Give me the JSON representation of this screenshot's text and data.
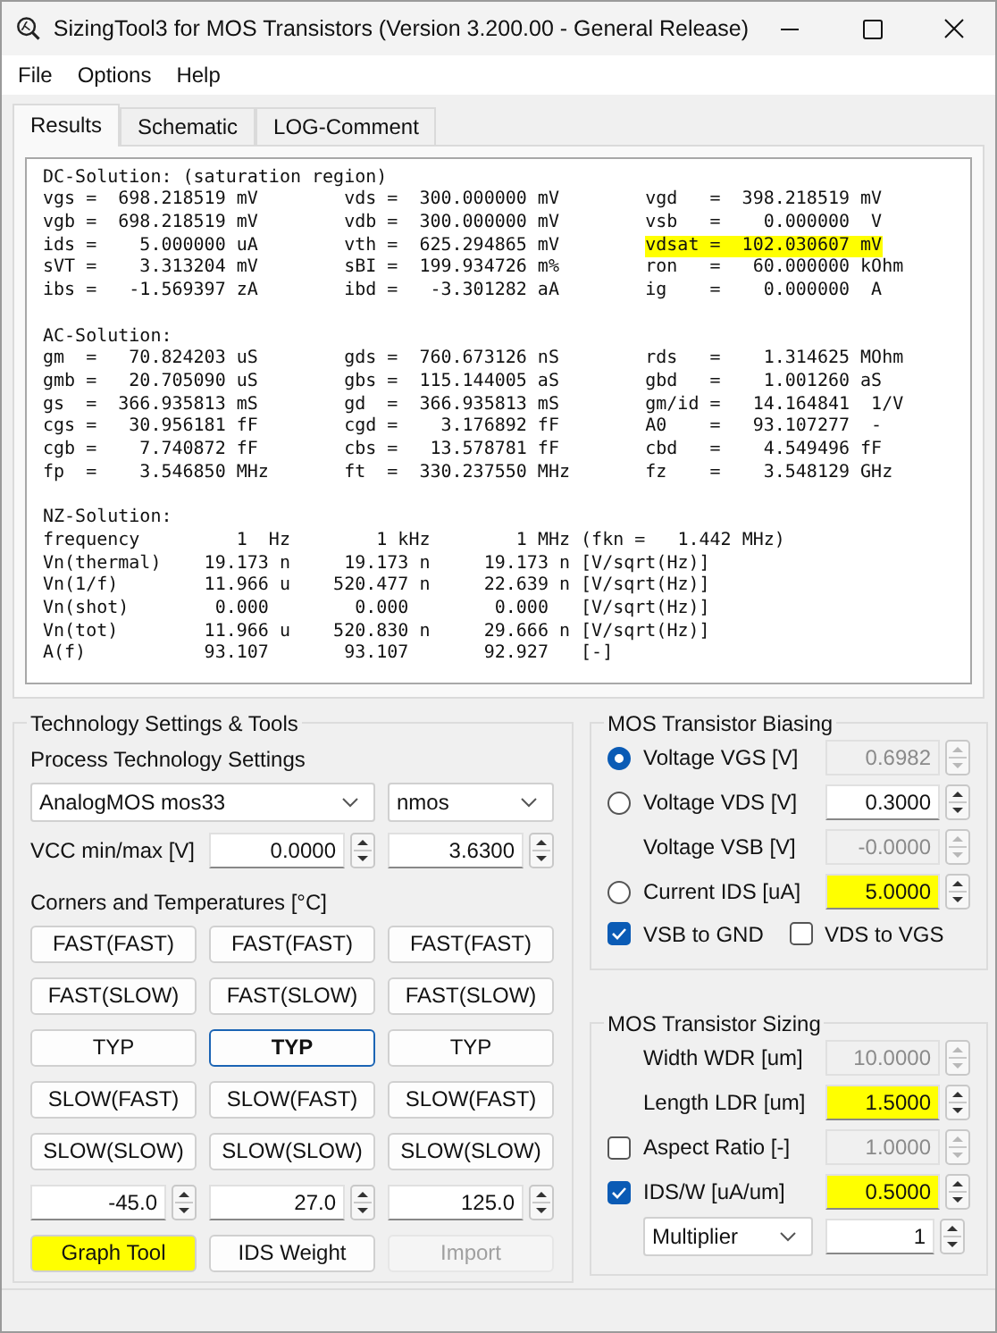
{
  "window": {
    "title": "SizingTool3 for MOS Transistors (Version 3.200.00 - General Release)"
  },
  "menu": [
    "File",
    "Options",
    "Help"
  ],
  "tabs": [
    {
      "label": "Results",
      "selected": true
    },
    {
      "label": "Schematic",
      "selected": false
    },
    {
      "label": "LOG-Comment",
      "selected": false
    }
  ],
  "results": [
    {
      "kind": "table",
      "title": "DC-Solution: (saturation region)",
      "rows": [
        [
          {
            "text": "vgs =  698.218519 mV",
            "highlighted": false
          },
          {
            "text": "vds =  300.000000 mV",
            "highlighted": false
          },
          {
            "text": "vgd   =  398.218519 mV",
            "highlighted": false
          }
        ],
        [
          {
            "text": "vgb =  698.218519 mV",
            "highlighted": false
          },
          {
            "text": "vdb =  300.000000 mV",
            "highlighted": false
          },
          {
            "text": "vsb   =    0.000000  V",
            "highlighted": false
          }
        ],
        [
          {
            "text": "ids =    5.000000 uA",
            "highlighted": false
          },
          {
            "text": "vth =  625.294865 mV",
            "highlighted": false
          },
          {
            "text": "vdsat =  102.030607 mV",
            "highlighted": true
          }
        ],
        [
          {
            "text": "sVT =    3.313204 mV",
            "highlighted": false
          },
          {
            "text": "sBI =  199.934726 m%",
            "highlighted": false
          },
          {
            "text": "ron   =   60.000000 kOhm",
            "highlighted": false
          }
        ],
        [
          {
            "text": "ibs =   -1.569397 zA",
            "highlighted": false
          },
          {
            "text": "ibd =   -3.301282 aA",
            "highlighted": false
          },
          {
            "text": "ig    =    0.000000  A",
            "highlighted": false
          }
        ]
      ]
    },
    {
      "kind": "table",
      "title": "AC-Solution:",
      "rows": [
        [
          {
            "text": "gm  =   70.824203 uS",
            "highlighted": false
          },
          {
            "text": "gds =  760.673126 nS",
            "highlighted": false
          },
          {
            "text": "rds   =    1.314625 MOhm",
            "highlighted": false
          }
        ],
        [
          {
            "text": "gmb =   20.705090 uS",
            "highlighted": false
          },
          {
            "text": "gbs =  115.144005 aS",
            "highlighted": false
          },
          {
            "text": "gbd   =    1.001260 aS",
            "highlighted": false
          }
        ],
        [
          {
            "text": "gs  =  366.935813 mS",
            "highlighted": false
          },
          {
            "text": "gd  =  366.935813 mS",
            "highlighted": false
          },
          {
            "text": "gm/id =   14.164841  1/V",
            "highlighted": false
          }
        ],
        [
          {
            "text": "cgs =   30.956181 fF",
            "highlighted": false
          },
          {
            "text": "cgd =    3.176892 fF",
            "highlighted": false
          },
          {
            "text": "A0    =   93.107277  -",
            "highlighted": false
          }
        ],
        [
          {
            "text": "cgb =    7.740872 fF",
            "highlighted": false
          },
          {
            "text": "cbs =   13.578781 fF",
            "highlighted": false
          },
          {
            "text": "cbd   =    4.549496 fF",
            "highlighted": false
          }
        ],
        [
          {
            "text": "fp  =    3.546850 MHz",
            "highlighted": false
          },
          {
            "text": "ft  =  330.237550 MHz",
            "highlighted": false
          },
          {
            "text": "fz    =    3.548129 GHz",
            "highlighted": false
          }
        ]
      ]
    },
    {
      "kind": "text",
      "title": "NZ-Solution:",
      "lines": [
        "frequency         1  Hz        1 kHz        1 MHz (fkn =   1.442 MHz)",
        "Vn(thermal)    19.173 n     19.173 n     19.173 n [V/sqrt(Hz)]",
        "Vn(1/f)        11.966 u    520.477 n     22.639 n [V/sqrt(Hz)]",
        "Vn(shot)        0.000        0.000        0.000   [V/sqrt(Hz)]",
        "Vn(tot)        11.966 u    520.830 n     29.666 n [V/sqrt(Hz)]",
        "A(f)           93.107       93.107       92.927   [-]"
      ]
    }
  ],
  "technology": {
    "title": "Technology Settings & Tools",
    "process_label": "Process Technology Settings",
    "process": "AnalogMOS mos33",
    "device": "nmos",
    "vcc": {
      "label": "VCC min/max [V]",
      "min": "0.0000",
      "max": "3.6300"
    },
    "corners_label": "Corners and Temperatures [°C]",
    "corners": [
      [
        {
          "label": "FAST(FAST)",
          "focused": false
        },
        {
          "label": "FAST(FAST)",
          "focused": false
        },
        {
          "label": "FAST(FAST)",
          "focused": false
        }
      ],
      [
        {
          "label": "FAST(SLOW)",
          "focused": false
        },
        {
          "label": "FAST(SLOW)",
          "focused": false
        },
        {
          "label": "FAST(SLOW)",
          "focused": false
        }
      ],
      [
        {
          "label": "TYP",
          "focused": false
        },
        {
          "label": "TYP",
          "focused": true
        },
        {
          "label": "TYP",
          "focused": false
        }
      ],
      [
        {
          "label": "SLOW(FAST)",
          "focused": false
        },
        {
          "label": "SLOW(FAST)",
          "focused": false
        },
        {
          "label": "SLOW(FAST)",
          "focused": false
        }
      ],
      [
        {
          "label": "SLOW(SLOW)",
          "focused": false
        },
        {
          "label": "SLOW(SLOW)",
          "focused": false
        },
        {
          "label": "SLOW(SLOW)",
          "focused": false
        }
      ]
    ],
    "temperatures": [
      "-45.0",
      "27.0",
      "125.0"
    ],
    "buttons": [
      {
        "label": "Graph Tool",
        "highlighted": true,
        "disabled": false
      },
      {
        "label": "IDS Weight",
        "highlighted": false,
        "disabled": false
      },
      {
        "label": "Import",
        "highlighted": false,
        "disabled": true
      }
    ]
  },
  "biasing": {
    "title": "MOS Transistor Biasing",
    "rows": [
      {
        "kind": "radio",
        "label": "Voltage VGS [V]",
        "selected": true,
        "value": "0.6982",
        "disabled": true,
        "highlighted": false
      },
      {
        "kind": "radio",
        "label": "Voltage VDS [V]",
        "selected": false,
        "value": "0.3000",
        "disabled": false,
        "highlighted": false
      },
      {
        "kind": "plain",
        "label": "Voltage VSB [V]",
        "value": "-0.0000",
        "disabled": true,
        "highlighted": false
      },
      {
        "kind": "radio",
        "label": "Current IDS [uA]",
        "selected": false,
        "value": "5.0000",
        "disabled": false,
        "highlighted": true
      }
    ],
    "checkboxes": [
      {
        "label": "VSB to GND",
        "checked": true
      },
      {
        "label": "VDS to VGS",
        "checked": false
      }
    ]
  },
  "sizing": {
    "title": "MOS Transistor Sizing",
    "rows": [
      {
        "kind": "plain",
        "label": "Width WDR [um]",
        "value": "10.0000",
        "disabled": true,
        "highlighted": false
      },
      {
        "kind": "plain",
        "label": "Length LDR [um]",
        "value": "1.5000",
        "disabled": false,
        "highlighted": true
      },
      {
        "kind": "checkbox",
        "label": "Aspect Ratio [-]",
        "checked": false,
        "value": "1.0000",
        "disabled": true,
        "highlighted": false
      },
      {
        "kind": "checkbox",
        "label": "IDS/W [uA/um]",
        "checked": true,
        "value": "0.5000",
        "disabled": false,
        "highlighted": true
      }
    ],
    "multiplier": {
      "option": "Multiplier",
      "value": "1"
    }
  }
}
